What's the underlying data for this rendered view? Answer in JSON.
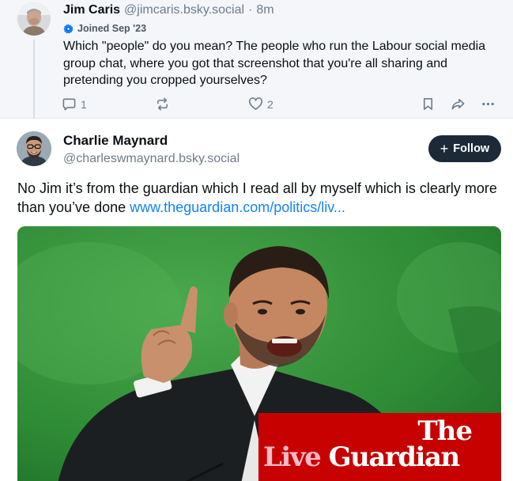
{
  "parent_post": {
    "author_name": "Jim Caris",
    "handle": "@jimcaris.bsky.social",
    "separator": "·",
    "time": "8m",
    "joined_badge": "Joined Sep '23",
    "text": "Which \"people\" do you mean? The people who run the Labour social media group chat, where you got that screenshot that you're all sharing and pretending you cropped yourselves?",
    "reply_count": "1",
    "like_count": "2"
  },
  "main_post": {
    "author_name": "Charlie Maynard",
    "handle": "@charleswmaynard.bsky.social",
    "follow_label": "Follow",
    "text": "No Jim it’s from the guardian which I read all by myself which is clearly more than you’ve done ",
    "link_text": "www.theguardian.com/politics/liv..."
  },
  "embed": {
    "logo_the": "The",
    "logo_live": "Live",
    "logo_guardian": "Guardian"
  },
  "icons": {
    "reply": "reply-icon",
    "repost": "repost-icon",
    "like": "heart-icon",
    "bookmark": "bookmark-icon",
    "share": "share-icon",
    "more": "more-icon",
    "badge": "verified-badge-icon"
  },
  "colors": {
    "link": "#1083fe",
    "follow_button_bg": "#1c2a38",
    "guardian_red": "#c70000",
    "live_pink": "#ffbac8",
    "muted_text": "#6f7c8c"
  }
}
